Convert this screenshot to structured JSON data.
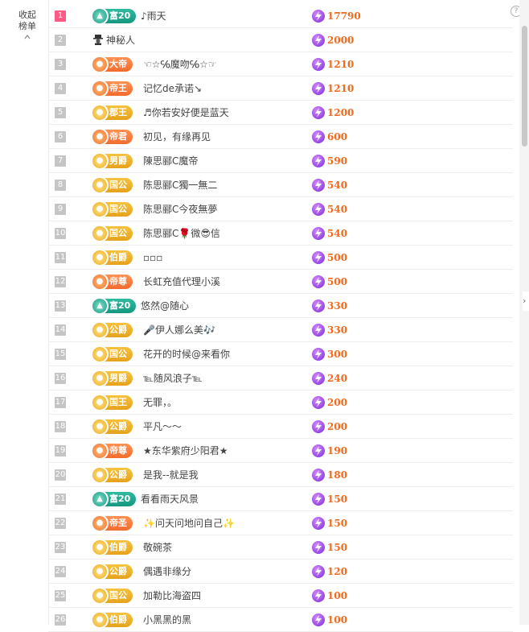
{
  "sidebar": {
    "collapse_label_1": "收起",
    "collapse_label_2": "榜单"
  },
  "help_label": "?",
  "colors": {
    "top_rank": "#ff5a86",
    "rank": "#c5c5c5",
    "value": "#f06a1e",
    "gold_badge": "#f0b02e",
    "orange_badge": "#f77a3a",
    "teal_badge": "#1fa98f"
  },
  "rows": [
    {
      "rank": "1",
      "badge": "富20",
      "badge_style": "teal",
      "name": "♪雨天",
      "value": "17790"
    },
    {
      "rank": "2",
      "badge": "",
      "badge_style": "anon",
      "name": "神秘人",
      "value": "2000"
    },
    {
      "rank": "3",
      "badge": "大帝",
      "badge_style": "orange",
      "name": "☜☆℅魔吻℅☆☞",
      "value": "1210"
    },
    {
      "rank": "4",
      "badge": "帝王",
      "badge_style": "orange",
      "name": "记忆de承诺↘",
      "value": "1210"
    },
    {
      "rank": "5",
      "badge": "郡王",
      "badge_style": "gold",
      "name": "♬你若安好便是蓝天",
      "value": "1200"
    },
    {
      "rank": "6",
      "badge": "帝君",
      "badge_style": "orange",
      "name": "初见，有缘再见",
      "value": "600"
    },
    {
      "rank": "7",
      "badge": "男爵",
      "badge_style": "gold",
      "name": "陳思郦C魔帝",
      "value": "590"
    },
    {
      "rank": "8",
      "badge": "国公",
      "badge_style": "gold",
      "name": "陈思郦C獨一無二",
      "value": "540"
    },
    {
      "rank": "9",
      "badge": "国公",
      "badge_style": "gold",
      "name": "陈思郦C今夜無夢",
      "value": "540"
    },
    {
      "rank": "10",
      "badge": "国公",
      "badge_style": "gold",
      "name": "陈思郦C🌹微😎信",
      "value": "540"
    },
    {
      "rank": "11",
      "badge": "伯爵",
      "badge_style": "gold",
      "name": "▫▫▫",
      "value": "500"
    },
    {
      "rank": "12",
      "badge": "帝尊",
      "badge_style": "orange",
      "name": "长虹充值代理小溪",
      "value": "500"
    },
    {
      "rank": "13",
      "badge": "富20",
      "badge_style": "teal",
      "name": "悠然@随心",
      "value": "330"
    },
    {
      "rank": "14",
      "badge": "公爵",
      "badge_style": "gold",
      "name": "🎤伊人娜么美🎶",
      "value": "330"
    },
    {
      "rank": "15",
      "badge": "国公",
      "badge_style": "gold",
      "name": "花开的时候@来看你",
      "value": "300"
    },
    {
      "rank": "16",
      "badge": "男爵",
      "badge_style": "gold",
      "name": "℡随风浪子℡",
      "value": "240"
    },
    {
      "rank": "17",
      "badge": "国王",
      "badge_style": "gold",
      "name": "无罪，。",
      "value": "200"
    },
    {
      "rank": "18",
      "badge": "公爵",
      "badge_style": "gold",
      "name": "平凡～～",
      "value": "200"
    },
    {
      "rank": "19",
      "badge": "帝尊",
      "badge_style": "orange",
      "name": "★东华紫府少阳君★",
      "value": "190"
    },
    {
      "rank": "20",
      "badge": "公爵",
      "badge_style": "gold",
      "name": "是我--就是我",
      "value": "180"
    },
    {
      "rank": "21",
      "badge": "富20",
      "badge_style": "teal",
      "name": "看看雨天风景",
      "value": "150"
    },
    {
      "rank": "22",
      "badge": "帝圣",
      "badge_style": "orange",
      "name": "✨问天问地问自己✨",
      "value": "150"
    },
    {
      "rank": "23",
      "badge": "伯爵",
      "badge_style": "gold",
      "name": "敬碗茶",
      "value": "150"
    },
    {
      "rank": "24",
      "badge": "公爵",
      "badge_style": "gold",
      "name": "偶遇非缘分",
      "value": "120"
    },
    {
      "rank": "25",
      "badge": "国公",
      "badge_style": "gold",
      "name": "加勒比海盗四",
      "value": "100"
    },
    {
      "rank": "26",
      "badge": "伯爵",
      "badge_style": "gold",
      "name": "小黑黑的黑",
      "value": "100"
    }
  ]
}
